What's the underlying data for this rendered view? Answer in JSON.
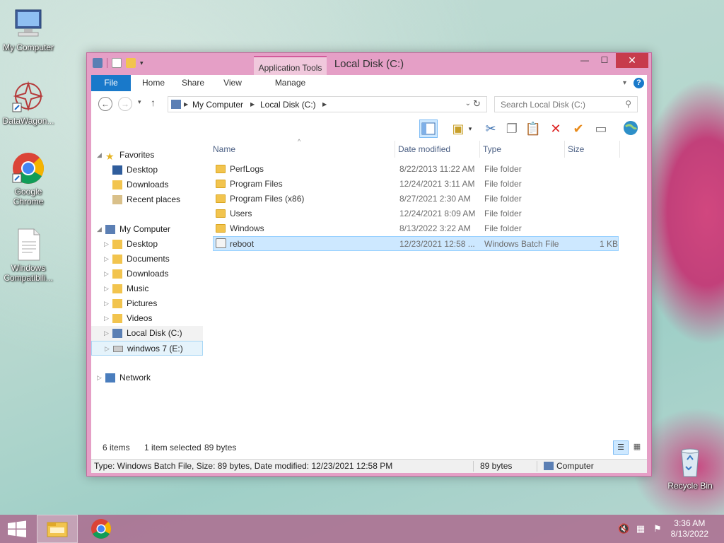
{
  "desktop": {
    "icons": [
      {
        "label": "My Computer",
        "icon": "computer-icon"
      },
      {
        "label": "DataWagon...",
        "icon": "datawagon-icon"
      },
      {
        "label": "Google\nChrome",
        "icon": "chrome-icon"
      },
      {
        "label": "Windows\nCompatibili...",
        "icon": "document-icon"
      },
      {
        "label": "Recycle Bin",
        "icon": "recycle-bin-icon"
      }
    ]
  },
  "window": {
    "title": "Local Disk (C:)",
    "context_tab": "Application Tools",
    "close_glyph": "✕",
    "minimize_glyph": "—",
    "maximize_glyph": "☐"
  },
  "ribbon": {
    "tabs": [
      "File",
      "Home",
      "Share",
      "View",
      "Manage"
    ]
  },
  "address": {
    "crumbs": [
      "My Computer",
      "Local Disk (C:)"
    ],
    "search_placeholder": "Search Local Disk (C:)"
  },
  "navpane": {
    "favorites": "Favorites",
    "fav_items": [
      "Desktop",
      "Downloads",
      "Recent places"
    ],
    "computer": "My Computer",
    "computer_items": [
      "Desktop",
      "Documents",
      "Downloads",
      "Music",
      "Pictures",
      "Videos",
      "Local Disk (C:)",
      "windwos 7 (E:)"
    ],
    "network": "Network"
  },
  "files": {
    "columns": [
      "Name",
      "Date modified",
      "Type",
      "Size"
    ],
    "rows": [
      {
        "name": "PerfLogs",
        "date": "8/22/2013 11:22 AM",
        "type": "File folder",
        "size": ""
      },
      {
        "name": "Program Files",
        "date": "12/24/2021 3:11 AM",
        "type": "File folder",
        "size": ""
      },
      {
        "name": "Program Files (x86)",
        "date": "8/27/2021 2:30 AM",
        "type": "File folder",
        "size": ""
      },
      {
        "name": "Users",
        "date": "12/24/2021 8:09 AM",
        "type": "File folder",
        "size": ""
      },
      {
        "name": "Windows",
        "date": "8/13/2022 3:22 AM",
        "type": "File folder",
        "size": ""
      },
      {
        "name": "reboot",
        "date": "12/23/2021 12:58 ...",
        "type": "Windows Batch File",
        "size": "1 KB"
      }
    ]
  },
  "status": {
    "items_count": "6 items",
    "selection": "1 item selected",
    "sel_size": "89 bytes",
    "details": "Type: Windows Batch File, Size: 89 bytes, Date modified: 12/23/2021 12:58 PM",
    "size2": "89 bytes",
    "location": "Computer"
  },
  "taskbar": {
    "time": "3:36 AM",
    "date": "8/13/2022"
  },
  "colors": {
    "accent": "#1979ca",
    "window_frame": "#e59fc6",
    "selection": "#cde8ff"
  }
}
